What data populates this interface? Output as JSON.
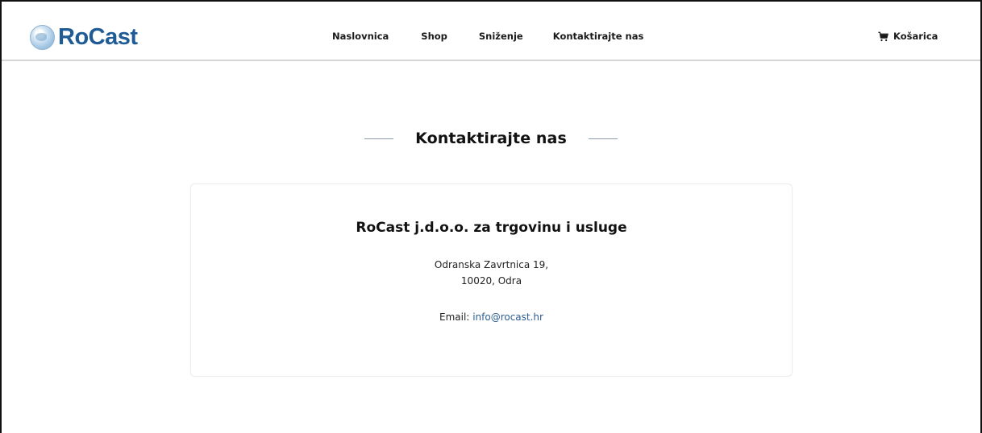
{
  "brand": {
    "name": "RoCast",
    "color": "#1f5b95"
  },
  "nav": {
    "items": [
      {
        "label": "Naslovnica"
      },
      {
        "label": "Shop"
      },
      {
        "label": "Sniženje"
      },
      {
        "label": "Kontaktirajte nas"
      }
    ]
  },
  "cart": {
    "label": "Košarica",
    "icon": "cart-icon"
  },
  "page": {
    "title": "Kontaktirajte nas"
  },
  "contact": {
    "company": "RoCast j.d.o.o. za trgovinu i usluge",
    "address_line1": "Odranska Zavrtnica 19,",
    "address_line2": "10020, Odra",
    "email_label": "Email:",
    "email": "info@rocast.hr",
    "link_color": "#2b5d93"
  }
}
